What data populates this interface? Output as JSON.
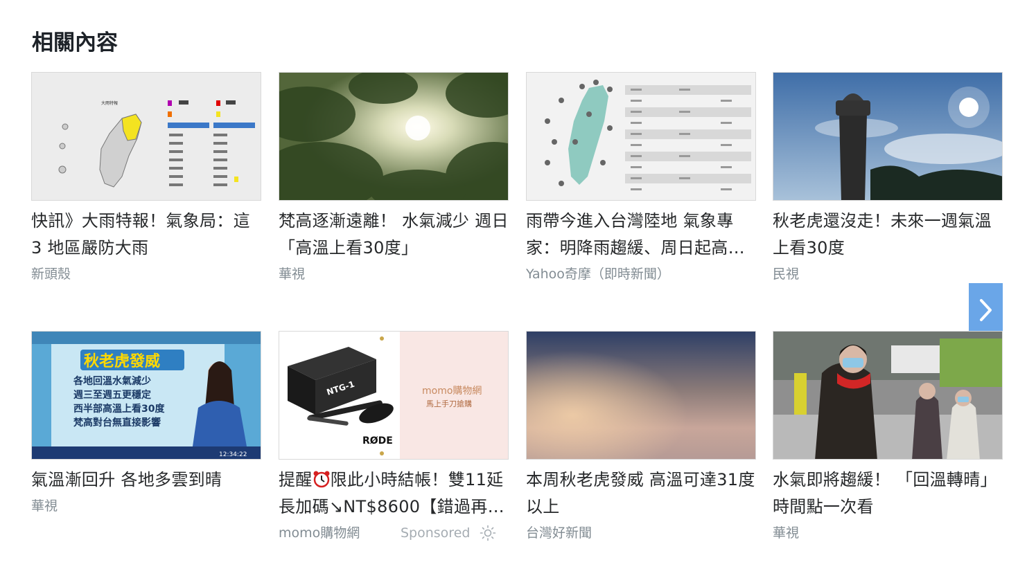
{
  "section": {
    "title": "相關內容"
  },
  "cards": [
    {
      "headline": "快訊》大雨特報！氣象局：這 3 地區嚴防大雨",
      "source": "新頭殼"
    },
    {
      "headline": "梵高逐漸遠離！ 水氣減少 週日「高溫上看30度」",
      "source": "華視"
    },
    {
      "headline": "雨帶今進入台灣陸地 氣象專家：明降雨趨緩、周日起高溫回升",
      "source": "Yahoo奇摩（即時新聞）"
    },
    {
      "headline": "秋老虎還沒走！未來一週氣溫上看30度",
      "source": "民視"
    },
    {
      "headline": "氣溫漸回升 各地多雲到晴",
      "source": "華視"
    },
    {
      "headline_part1": "提醒",
      "headline_part2": "限此小時結帳！雙11延長加碼↘NT$8600【錯過再等一年】",
      "source": "momo購物網",
      "sponsored": "Sponsored"
    },
    {
      "headline": "本周秋老虎發威 高溫可達31度以上",
      "source": "台灣好新聞"
    },
    {
      "headline": "水氣即將趨緩！ 「回溫轉晴」時間點一次看",
      "source": "華視"
    }
  ],
  "thumb_text": {
    "map_label": "大雨特報",
    "weather_title": "秋老虎發威",
    "weather_bullets": [
      "各地回溫水氣減少",
      "週三至週五更穩定",
      "西半部高溫上看30度",
      "梵高對台無直接影響"
    ],
    "weather_time": "12:34:22",
    "ad_brand": "momo購物網",
    "ad_slogan": "馬上手刀搶購",
    "ad_product": "NTG-1",
    "ad_maker": "RØDE"
  },
  "colors": {
    "accent": "#6aa6e8",
    "source_gray": "#828c93",
    "headline": "#26282a"
  },
  "icons": {
    "next": "chevron-right-icon",
    "sponsored": "sun-info-icon",
    "alarm": "alarm-clock-icon"
  }
}
